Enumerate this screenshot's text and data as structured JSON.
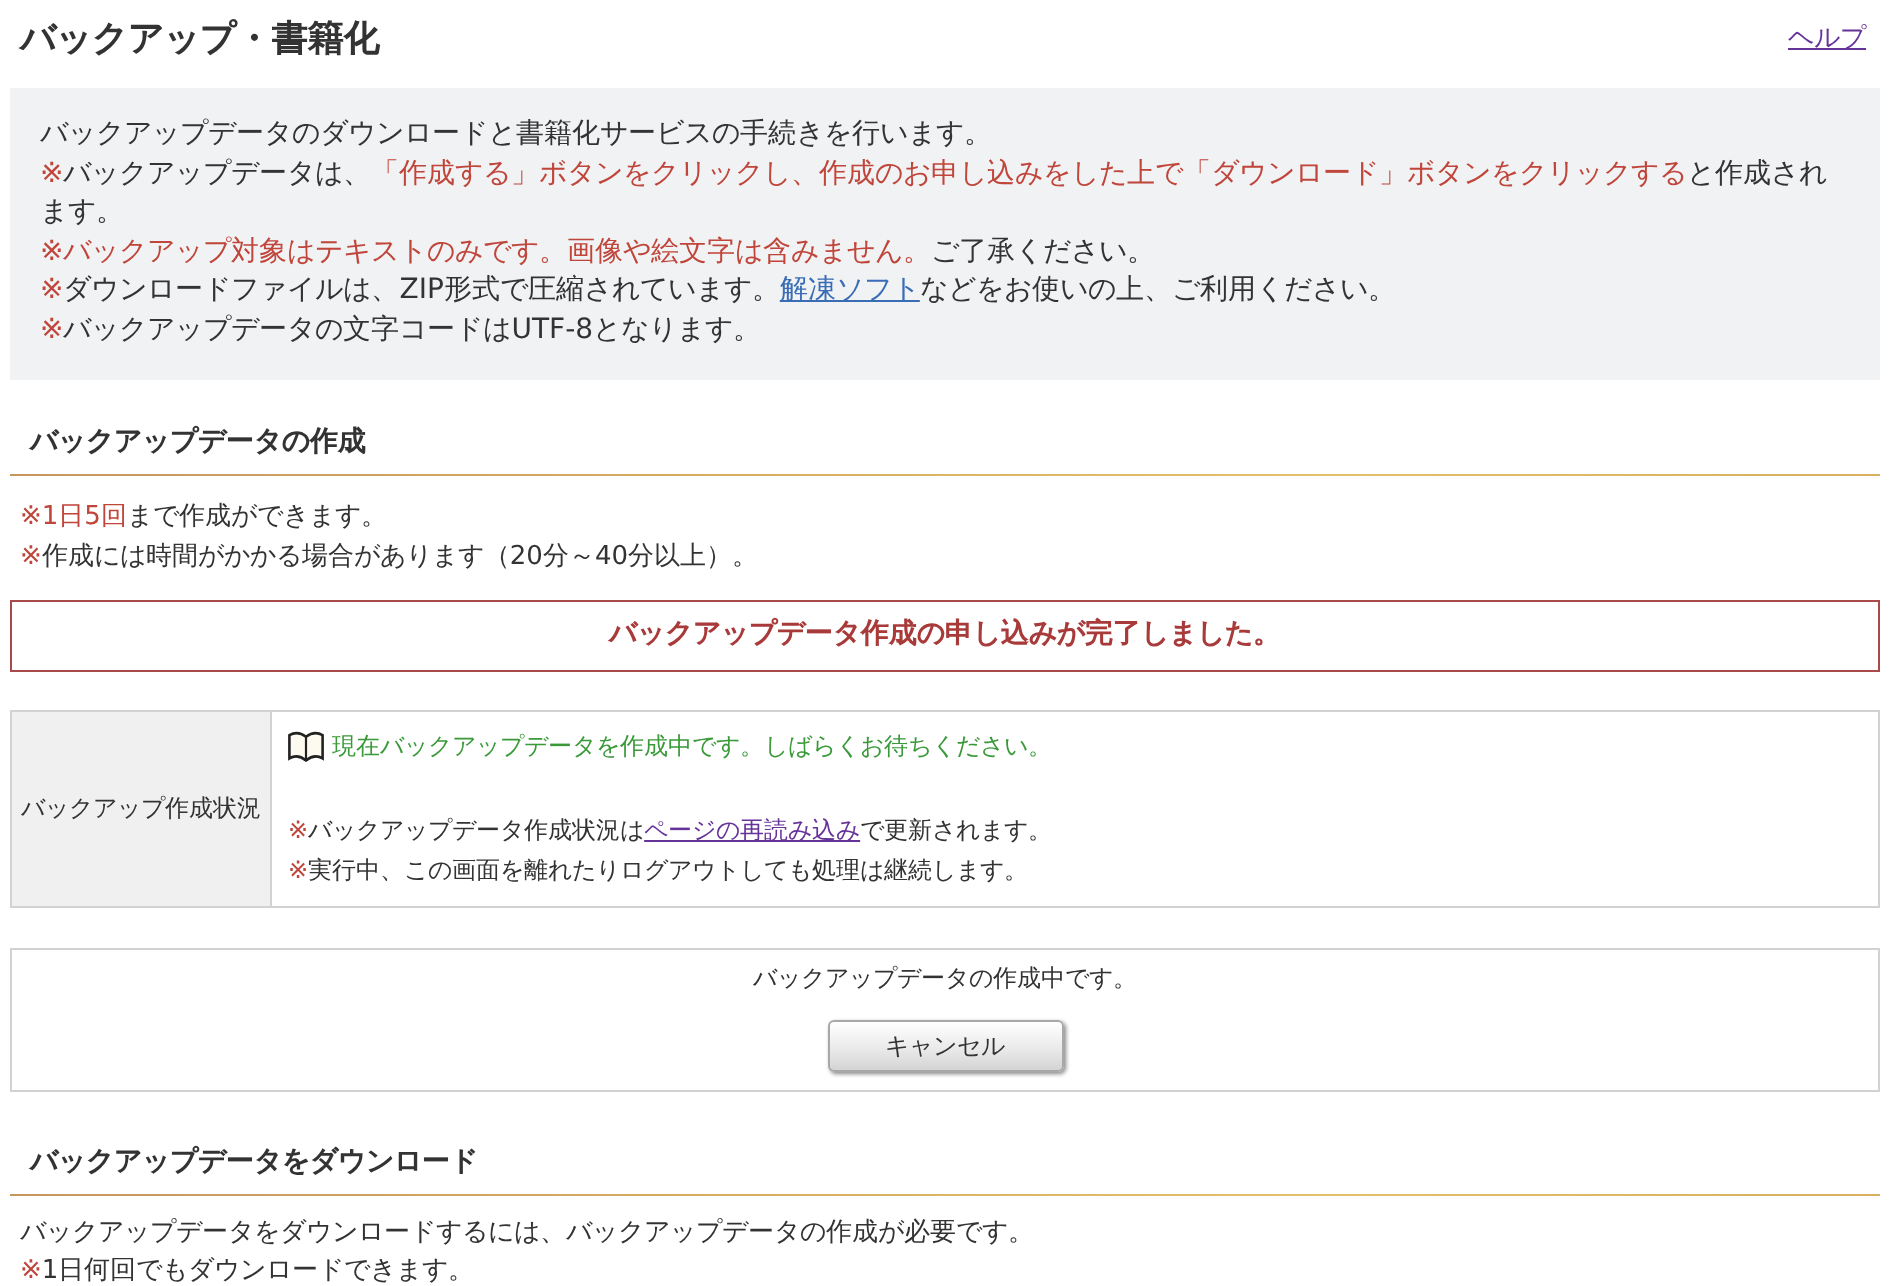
{
  "header": {
    "title": "バックアップ・書籍化",
    "help_link": {
      "text": "ヘルプ",
      "visited": true
    }
  },
  "intro": {
    "lines": [
      [
        {
          "kind": "plain",
          "text": "バックアップデータのダウンロードと書籍化サービスの手続きを行います。"
        }
      ],
      [
        {
          "kind": "warning",
          "text": "※"
        },
        {
          "kind": "plain",
          "text": "バックアップデータは、"
        },
        {
          "kind": "warning",
          "text": "「作成する」ボタンをクリックし、作成のお申し込みをした上で「ダウンロード」ボタンをクリックする"
        },
        {
          "kind": "plain",
          "text": "と作成されます。"
        }
      ],
      [
        {
          "kind": "warning",
          "text": "※バックアップ対象はテキストのみです。画像や絵文字は含みません。"
        },
        {
          "kind": "plain",
          "text": "ご了承ください。"
        }
      ],
      [
        {
          "kind": "warning",
          "text": "※"
        },
        {
          "kind": "plain",
          "text": "ダウンロードファイルは、ZIP形式で圧縮されています。"
        },
        {
          "kind": "link",
          "text": "解凍ソフト",
          "visited": false
        },
        {
          "kind": "plain",
          "text": "などをお使いの上、ご利用ください。"
        }
      ],
      [
        {
          "kind": "warning",
          "text": "※"
        },
        {
          "kind": "plain",
          "text": "バックアップデータの文字コードはUTF-8となります。"
        }
      ]
    ]
  },
  "create_section": {
    "heading": "バックアップデータの作成",
    "notes": [
      [
        {
          "kind": "warning",
          "text": "※1日5回"
        },
        {
          "kind": "plain",
          "text": "まで作成ができます。"
        }
      ],
      [
        {
          "kind": "warning",
          "text": "※"
        },
        {
          "kind": "plain",
          "text": "作成には時間がかかる場合があります（20分～40分以上）。"
        }
      ]
    ],
    "alert": "バックアップデータ作成の申し込みが完了しました。",
    "status_table": {
      "label": "バックアップ作成状況",
      "status": {
        "kind": "in-progress",
        "text": "現在バックアップデータを作成中です。しばらくお待ちください。"
      },
      "notes": [
        [
          {
            "kind": "warning",
            "text": "※"
          },
          {
            "kind": "plain",
            "text": "バックアップデータ作成状況は"
          },
          {
            "kind": "link",
            "text": "ページの再読み込み",
            "visited": true
          },
          {
            "kind": "plain",
            "text": "で更新されます。"
          }
        ],
        [
          {
            "kind": "warning",
            "text": "※"
          },
          {
            "kind": "plain",
            "text": "実行中、この画面を離れたりログアウトしても処理は継続します。"
          }
        ]
      ]
    },
    "progress_box": {
      "message": "バックアップデータの作成中です。",
      "cancel_button": "キャンセル"
    }
  },
  "download_section": {
    "heading": "バックアップデータをダウンロード",
    "lines": [
      [
        {
          "kind": "plain",
          "text": "バックアップデータをダウンロードするには、バックアップデータの作成が必要です。"
        }
      ],
      [
        {
          "kind": "warning",
          "text": "※"
        },
        {
          "kind": "plain",
          "text": "1日何回でもダウンロードできます。"
        }
      ]
    ]
  }
}
